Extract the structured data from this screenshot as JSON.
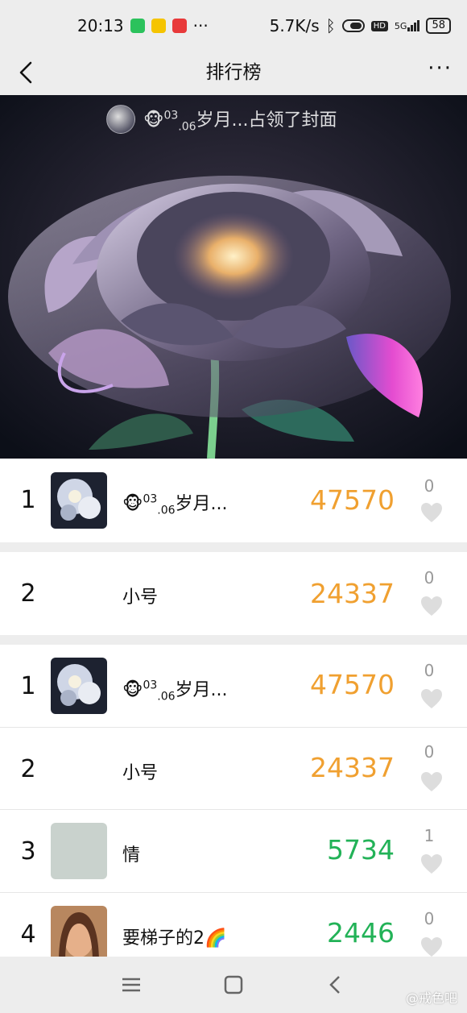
{
  "status": {
    "time": "20:13",
    "dots": "···",
    "network_speed": "5.7K/s",
    "hd": "HD",
    "signal": "5G",
    "battery": "58"
  },
  "nav": {
    "title": "排行榜",
    "more": "···"
  },
  "cover": {
    "caption_emoji": "🐵",
    "caption_sup": "03",
    "caption_sub": ".06",
    "caption_text": "岁月...占领了封面"
  },
  "top_list": [
    {
      "rank": "1",
      "emoji": "🐵",
      "sup": "03",
      "sub": ".06",
      "name": "岁月...",
      "steps": "47570",
      "likes": "0"
    },
    {
      "rank": "2",
      "name": "小号",
      "steps": "24337",
      "likes": "0"
    }
  ],
  "list": [
    {
      "rank": "1",
      "emoji": "🐵",
      "sup": "03",
      "sub": ".06",
      "name": "岁月...",
      "steps": "47570",
      "likes": "0"
    },
    {
      "rank": "2",
      "name": "小号",
      "steps": "24337",
      "likes": "0"
    },
    {
      "rank": "3",
      "name": "情",
      "steps": "5734",
      "likes": "1"
    },
    {
      "rank": "4",
      "name": "要梯子的2🌈",
      "steps": "2446",
      "likes": "0"
    }
  ],
  "watermark": "@戒色吧",
  "colors": {
    "orange": "#f0a030",
    "green": "#22b257"
  }
}
